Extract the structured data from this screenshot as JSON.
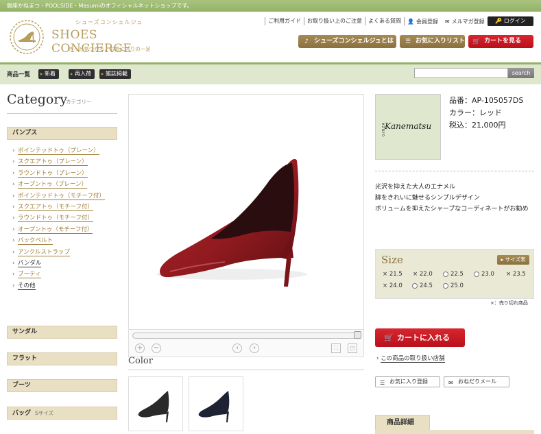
{
  "topbar": {
    "text": "銀座かねまつ・POOLSIDE・Masumiのオフィシャルネットショップです。"
  },
  "logo": {
    "subtitle": "シューズコンシェルジュ",
    "name": "SHOES CONCIERGE",
    "tagline": "きっと見つかる、お気に入りの一足"
  },
  "utility_nav": [
    "ご利用ガイド",
    "お取り扱い上のご注意",
    "よくある質問"
  ],
  "account": {
    "member": "会員登録",
    "newsletter": "メルマガ登録",
    "login": "ログイン"
  },
  "header_buttons": {
    "concierge": "シューズコンシェルジュとは",
    "favorites": "お気に入りリスト",
    "cart": "カートを見る"
  },
  "nav": {
    "label": "商品一覧",
    "items": [
      "新着",
      "再入荷",
      "雑誌掲載"
    ]
  },
  "search": {
    "button": "search",
    "placeholder": ""
  },
  "sidebar": {
    "title": "Category",
    "subtitle": "カテゴリー",
    "sections": {
      "pumps": "パンプス",
      "sandal": "サンダル",
      "flat": "フラット",
      "boots": "ブーツ",
      "bag": "バッグ",
      "bag_note": "Sサイズ"
    },
    "pumps_items": [
      "ポインテッドトゥ（プレーン）",
      "スクエアトゥ（プレーン）",
      "ラウンドトゥ（プレーン）",
      "オープントゥ（プレーン）",
      "ポインテッドトゥ（モチーフ付）",
      "スクエアトゥ（モチーフ付）",
      "ラウンドトゥ（モチーフ付）",
      "オープントゥ（モチーフ付）",
      "バックベルト",
      "アンクルストラップ",
      "バンダル",
      "ブーティ",
      "その他"
    ]
  },
  "product": {
    "brand": {
      "small": "GINZA",
      "name": "Kanematsu"
    },
    "code_label": "品番：AP-105057DS",
    "color_label": "カラー：レッド",
    "price_label": "税込：21,000円",
    "description": [
      "光沢を抑えた大人のエナメル",
      "脚をきれいに魅せるシンプルデザイン",
      "ボリュームを抑えたシャープなコーディネートがお勧め"
    ],
    "color_title": "Color",
    "thumbnail_colors": [
      "black",
      "navy"
    ],
    "main_color": "#8e1a1f"
  },
  "size": {
    "title": "Size",
    "chart_button": "サイズ表",
    "options": [
      {
        "label": "21.5",
        "available": false
      },
      {
        "label": "22.0",
        "available": false
      },
      {
        "label": "22.5",
        "available": true
      },
      {
        "label": "23.0",
        "available": true
      },
      {
        "label": "23.5",
        "available": false
      },
      {
        "label": "24.0",
        "available": false
      },
      {
        "label": "24.5",
        "available": true
      },
      {
        "label": "25.0",
        "available": true
      }
    ],
    "note": "×：売り切れ商品"
  },
  "actions": {
    "add_to_cart": "カートに入れる",
    "stores": "この商品の取り扱い店舗",
    "add_favorite": "お気に入り登録",
    "request_mail": "おねだりメール"
  },
  "details_tab": "商品詳細"
}
